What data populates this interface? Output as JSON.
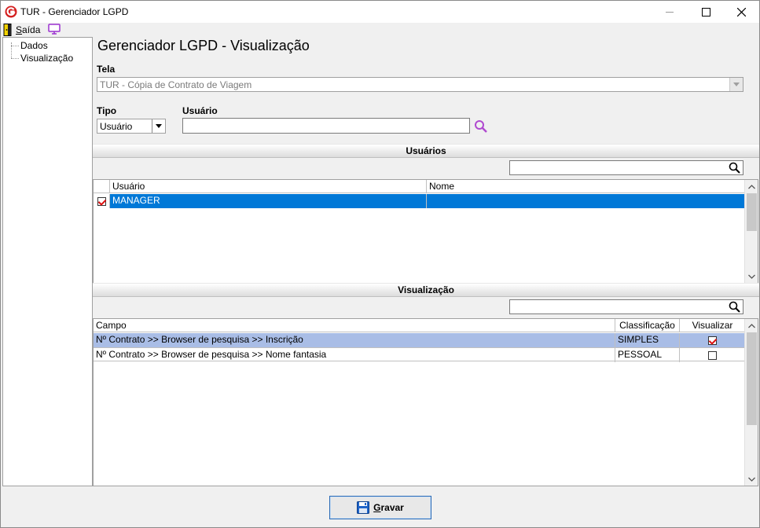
{
  "window": {
    "title": "TUR - Gerenciador LGPD"
  },
  "menu": {
    "exit_label_first": "S",
    "exit_label_rest": "aída"
  },
  "tree": {
    "items": [
      {
        "label": "Dados"
      },
      {
        "label": "Visualização"
      }
    ]
  },
  "page": {
    "title": "Gerenciador LGPD - Visualização"
  },
  "form": {
    "tela_label": "Tela",
    "tela_value": "TUR - Cópia de Contrato de Viagem",
    "tipo_label": "Tipo",
    "tipo_value": "Usuário",
    "usuario_label": "Usuário",
    "usuario_value": ""
  },
  "users_section": {
    "title": "Usuários",
    "search_value": "",
    "columns": [
      "Usuário",
      "Nome"
    ],
    "rows": [
      {
        "checked": true,
        "usuario": "MANAGER",
        "nome": ""
      }
    ]
  },
  "view_section": {
    "title": "Visualização",
    "search_value": "",
    "columns": [
      "Campo",
      "Classificação",
      "Visualizar"
    ],
    "rows": [
      {
        "campo": "Nº Contrato >> Browser de pesquisa >> Inscrição",
        "classificacao": "SIMPLES",
        "visualizar": true
      },
      {
        "campo": "Nº Contrato >> Browser de pesquisa >> Nome fantasia",
        "classificacao": "PESSOAL",
        "visualizar": false
      }
    ]
  },
  "footer": {
    "save_first": "G",
    "save_rest": "ravar"
  },
  "colors": {
    "selection_blue": "#0078d7",
    "selection_light": "#a9bde6",
    "search_icon_purple": "#b04ad0"
  }
}
